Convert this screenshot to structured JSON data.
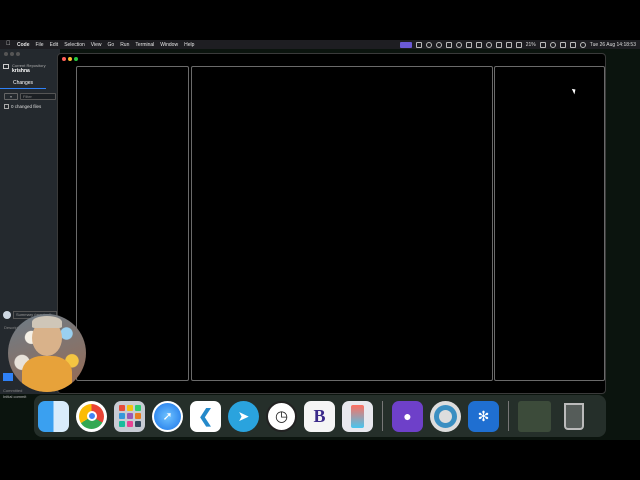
{
  "menubar": {
    "app_name": "Code",
    "items": [
      "File",
      "Edit",
      "Selection",
      "View",
      "Go",
      "Run",
      "Terminal",
      "Window",
      "Help"
    ],
    "battery": "21%",
    "datetime": "Tue 26 Aug  14:18:53"
  },
  "github_desktop": {
    "repo_label": "Current Repository",
    "repo_name": "krishna",
    "changes_tab": "Changes",
    "filter_placeholder": "Filter",
    "changed_files": "0 changed files",
    "summary_placeholder": "Summary (required)",
    "description_placeholder": "Description",
    "committed_label": "Committed",
    "last_commit": "Initial commit"
  },
  "dock": {
    "items": [
      "finder-icon",
      "chrome-icon",
      "launchpad-icon",
      "safari-icon",
      "vscode-icon",
      "telegram-icon",
      "clock-icon",
      "bbedit-icon",
      "iphone-mirroring-icon",
      "github-desktop-icon",
      "quicktime-icon",
      "system-settings-icon",
      "preview-icon",
      "trash-icon"
    ]
  },
  "colors": {
    "accent": "#2f81f7",
    "desktop": "#0b140e"
  }
}
